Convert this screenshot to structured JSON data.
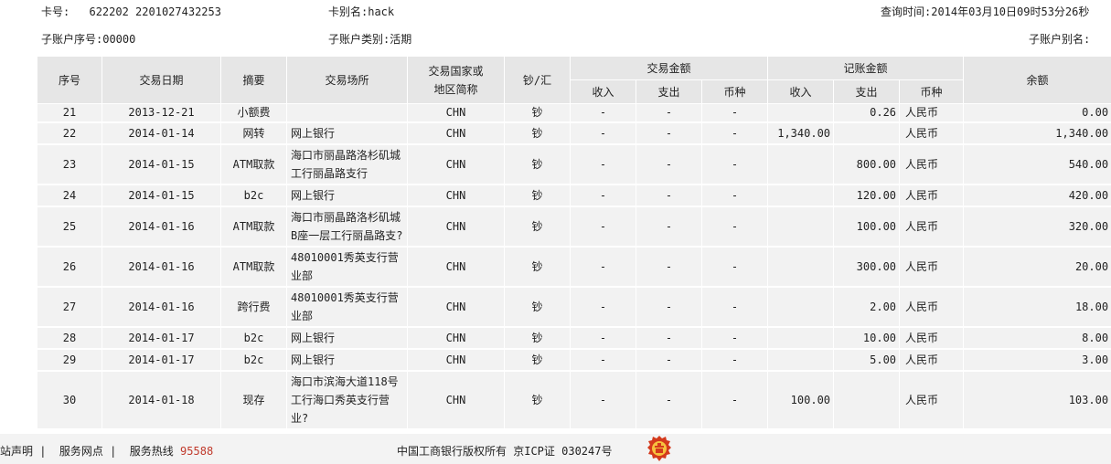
{
  "header": {
    "card_no_label": "卡号:",
    "card_no_value": "622202 2201027432253",
    "card_alias_label": "卡别名:",
    "card_alias_value": "hack",
    "query_time_label": "查询时间:",
    "query_time_value": "2014年03月10日09时53分26秒",
    "sub_account_no_label": "子账户序号:",
    "sub_account_no_value": "00000",
    "sub_account_type_label": "子账户类别:",
    "sub_account_type_value": "活期",
    "sub_account_alias_label": "子账户别名:",
    "sub_account_alias_value": ""
  },
  "table": {
    "headers": {
      "seq": "序号",
      "date": "交易日期",
      "summary": "摘要",
      "place": "交易场所",
      "country_line1": "交易国家或",
      "country_line2": "地区简称",
      "cash_remit": "钞/汇",
      "txn_amount": "交易金额",
      "book_amount": "记账金额",
      "income": "收入",
      "expense": "支出",
      "currency": "币种",
      "balance": "余额"
    },
    "rows": [
      {
        "seq": "21",
        "date": "2013-12-21",
        "summary": "小额费",
        "place": "",
        "country": "CHN",
        "cash": "钞",
        "t_in": "-",
        "t_out": "-",
        "t_cur": "-",
        "b_in": "",
        "b_out": "0.26",
        "b_cur": "人民币",
        "balance": "0.00"
      },
      {
        "seq": "22",
        "date": "2014-01-14",
        "summary": "网转",
        "place": "网上银行",
        "country": "CHN",
        "cash": "钞",
        "t_in": "-",
        "t_out": "-",
        "t_cur": "-",
        "b_in": "1,340.00",
        "b_out": "",
        "b_cur": "人民币",
        "balance": "1,340.00"
      },
      {
        "seq": "23",
        "date": "2014-01-15",
        "summary": "ATM取款",
        "place": "海口市丽晶路洛杉矶城工行丽晶路支行",
        "country": "CHN",
        "cash": "钞",
        "t_in": "-",
        "t_out": "-",
        "t_cur": "-",
        "b_in": "",
        "b_out": "800.00",
        "b_cur": "人民币",
        "balance": "540.00"
      },
      {
        "seq": "24",
        "date": "2014-01-15",
        "summary": "b2c",
        "place": "网上银行",
        "country": "CHN",
        "cash": "钞",
        "t_in": "-",
        "t_out": "-",
        "t_cur": "-",
        "b_in": "",
        "b_out": "120.00",
        "b_cur": "人民币",
        "balance": "420.00"
      },
      {
        "seq": "25",
        "date": "2014-01-16",
        "summary": "ATM取款",
        "place": "海口市丽晶路洛杉矶城B座一层工行丽晶路支?",
        "country": "CHN",
        "cash": "钞",
        "t_in": "-",
        "t_out": "-",
        "t_cur": "-",
        "b_in": "",
        "b_out": "100.00",
        "b_cur": "人民币",
        "balance": "320.00"
      },
      {
        "seq": "26",
        "date": "2014-01-16",
        "summary": "ATM取款",
        "place": "48010001秀英支行营业部",
        "country": "CHN",
        "cash": "钞",
        "t_in": "-",
        "t_out": "-",
        "t_cur": "-",
        "b_in": "",
        "b_out": "300.00",
        "b_cur": "人民币",
        "balance": "20.00"
      },
      {
        "seq": "27",
        "date": "2014-01-16",
        "summary": "跨行费",
        "place": "48010001秀英支行营业部",
        "country": "CHN",
        "cash": "钞",
        "t_in": "-",
        "t_out": "-",
        "t_cur": "-",
        "b_in": "",
        "b_out": "2.00",
        "b_cur": "人民币",
        "balance": "18.00"
      },
      {
        "seq": "28",
        "date": "2014-01-17",
        "summary": "b2c",
        "place": "网上银行",
        "country": "CHN",
        "cash": "钞",
        "t_in": "-",
        "t_out": "-",
        "t_cur": "-",
        "b_in": "",
        "b_out": "10.00",
        "b_cur": "人民币",
        "balance": "8.00"
      },
      {
        "seq": "29",
        "date": "2014-01-17",
        "summary": "b2c",
        "place": "网上银行",
        "country": "CHN",
        "cash": "钞",
        "t_in": "-",
        "t_out": "-",
        "t_cur": "-",
        "b_in": "",
        "b_out": "5.00",
        "b_cur": "人民币",
        "balance": "3.00"
      },
      {
        "seq": "30",
        "date": "2014-01-18",
        "summary": "现存",
        "place": "海口市滨海大道118号工行海口秀英支行营业?",
        "country": "CHN",
        "cash": "钞",
        "t_in": "-",
        "t_out": "-",
        "t_cur": "-",
        "b_in": "100.00",
        "b_out": "",
        "b_cur": "人民币",
        "balance": "103.00"
      }
    ]
  },
  "footer": {
    "links_text": "站声明 |  服务网点 |  服务热线",
    "hotline_number": "95588",
    "copyright": "中国工商银行版权所有  京ICP证 030247号",
    "emblem_icon": "police-emblem-icon",
    "emblem_color": "#d43a1c"
  }
}
